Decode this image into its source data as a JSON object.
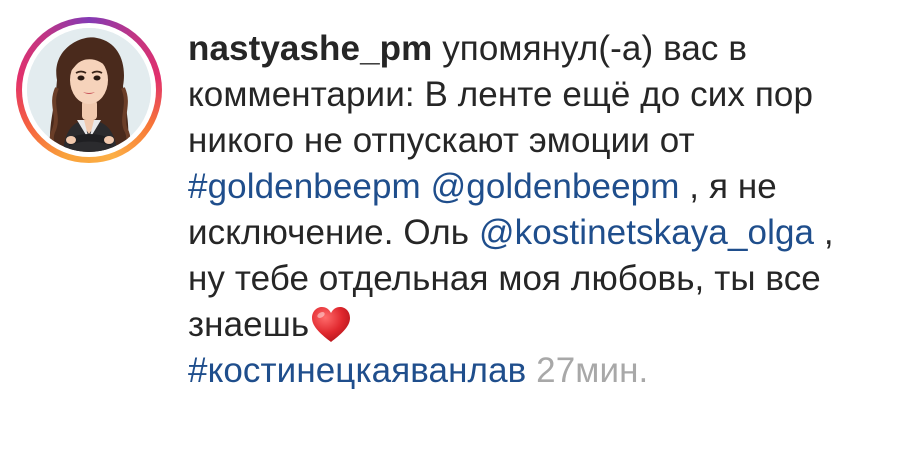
{
  "notification": {
    "username": "nastyashe_pm",
    "action_text": " упомянул(-а) вас в комментарии: В ленте ещё до сих пор никого не отпускают эмоции от ",
    "hashtag_1": "#goldenbeepm",
    "mention_1": "@goldenbeepm",
    "text_2": " , я не исключение. Оль ",
    "mention_2": "@kostinetskaya_olga",
    "text_3": " , ну тебе отдельная моя любовь, ты все знаешь",
    "heart_icon": "red-heart-icon",
    "hashtag_2": "#костинецкаяванлав",
    "timestamp": "27мин.",
    "colors": {
      "text": "#262626",
      "link": "#1f4e8c",
      "timestamp": "#a8a8a8",
      "heart": "#e0282e"
    }
  }
}
